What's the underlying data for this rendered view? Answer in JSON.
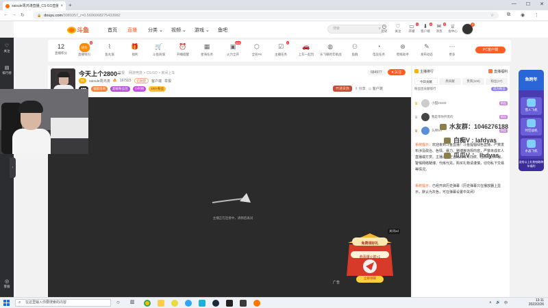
{
  "browser": {
    "tab_title": "saisule周鸿涛直播_CS:GO直播...",
    "url_host": "douyu.com",
    "url_path": "/3089357_r=0.5606068275433982",
    "tab_close": "×",
    "new_tab": "+",
    "win_min": "—",
    "win_max": "☐",
    "win_close": "✕"
  },
  "leftbar": {
    "follow": "关注",
    "history": "排行榜",
    "settings": "客服"
  },
  "header": {
    "logo": "斗鱼",
    "nav": [
      "首页",
      "直播",
      "分类",
      "视频",
      "游戏",
      "鱼吧"
    ],
    "search_placeholder": "搜索",
    "icons": [
      {
        "label": "历史"
      },
      {
        "label": "关注"
      },
      {
        "label": "开播",
        "badge": "1"
      },
      {
        "label": "客户端",
        "badge": "4"
      },
      {
        "label": "消息",
        "badge": "2"
      },
      {
        "label": "会中心"
      }
    ]
  },
  "funcbar": {
    "level": "12",
    "level_label": "直播积分",
    "items": [
      {
        "label": "直播钱包",
        "badge": "3",
        "wallet": "钱包"
      },
      {
        "label": "鱼丸值"
      },
      {
        "label": "福利"
      },
      {
        "label": "斗鱼商城"
      },
      {
        "label": "开播提醒"
      },
      {
        "label": "星海任务"
      },
      {
        "label": "火力全开",
        "badge": "new"
      },
      {
        "label": "全民PK"
      },
      {
        "label": "主播任务"
      },
      {
        "label": "上车一起玩"
      },
      {
        "label": "乐飞碟跨年挑战"
      },
      {
        "label": "鱼群"
      },
      {
        "label": "电竞任务"
      },
      {
        "label": "壁纸助手"
      },
      {
        "label": "发布动态"
      },
      {
        "label": "更多"
      }
    ],
    "pc_button": "PC客户端"
  },
  "room": {
    "title": "今天上个2800~",
    "report": "举报",
    "category_path": "网游竞技 > CS:GO > 房间上车",
    "streamer_name": "saisule周鸿涛",
    "hot": "167923",
    "badges": [
      "已封禁",
      "福星房间",
      "超级粉丝团",
      "小时榜",
      "100+粉丝"
    ],
    "room_id": "3089357",
    "fans_count": "684977",
    "follow": "关注",
    "share": "分享",
    "client": "客户端",
    "report_room": "举报",
    "hui": "开通贵族"
  },
  "player": {
    "loading_text": "主播正在连接中，请稍后再试",
    "ad_close": "关闭ad",
    "ad_label": "广告",
    "ad_title": "免费领好礼",
    "ad_sub": "恭喜爆火箭+1",
    "ad_btn": "立即领取"
  },
  "chat": {
    "tab_rank": "主播排行",
    "tab_guard": "直播福利",
    "tabs": [
      "今日贡献",
      "周贡献",
      "贵宾(100)",
      "粉丝(17)"
    ],
    "rank_title": "粉丝团贡献排行",
    "rank_badge": "成为粉丝",
    "rows": [
      {
        "name": "小甜23333",
        "lv": "粉丝"
      },
      {
        "name": "我是带你开黑的",
        "lv": "粉丝"
      },
      {
        "name": "头牌fxn",
        "lv": "粉丝"
      }
    ],
    "sys1_tag": "系统提示：",
    "sys1": "欢迎来到斗鱼直播！斗鱼提倡绿色直播，严禁发布涉及政治、色情、暴力、赌博等违规内容，严禁未成年人直播或打赏。主播以不正当方式诱导打赏、注意谨防诈骗，警惕网络赌博、代练代充，购买礼物请谨慎，切勿私下交易等情况。",
    "sys2_tag": "系统提示：",
    "sys2": "已经开启历史弹幕（历史弹幕只在播放器上显示，默认为灰色，可在弹幕设置中关闭）",
    "danmu": [
      "水友群：1046276188",
      "白痴V : lafdyas",
      "瓜瓜V ： lbdyas"
    ]
  },
  "promo": {
    "top": "鱼跨年",
    "items": [
      "雪人飞机",
      "时空战机",
      "水晶飞机"
    ],
    "bottom": "送给以上礼物抽取跨年福利"
  },
  "taskbar": {
    "search": "在这里输入你要搜索的内容",
    "time": "13:11",
    "date": "2022/2/26",
    "lang": "中"
  }
}
